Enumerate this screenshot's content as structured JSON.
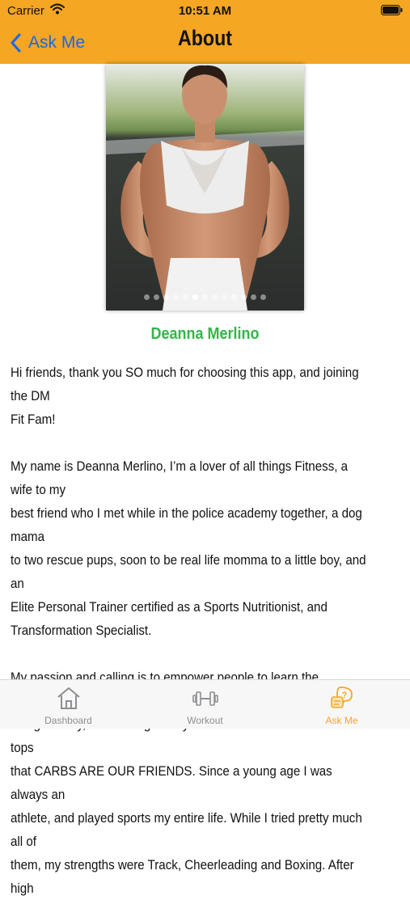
{
  "status_bar": {
    "carrier": "Carrier",
    "time": "10:51 AM"
  },
  "nav": {
    "back_label": "Ask Me",
    "title": "About"
  },
  "carousel": {
    "page_count": 13,
    "current_page": 5
  },
  "profile": {
    "name": "Deanna Merlino",
    "bio": "Hi friends, thank you SO much for choosing this app, and joining the DM\nFit Fam!\n\nMy name is Deanna Merlino, I’m a lover of all things Fitness, a wife to my\nbest friend who I met while in the police academy together, a dog mama\nto two rescue pups, soon to be real life momma to a little boy, and an\nElite Personal Trainer certified as a Sports Nutritionist, and\nTransformation Specialist.\n\nMy passion and calling is to empower people to learn the importance of\nbeing healthy, over \"being skinny\" and scream from the mountain tops\nthat CARBS ARE OUR FRIENDS. Since a young age I was always an\nathlete, and played sports my entire life. While I tried pretty much all of\nthem, my strengths were Track, Cheerleading and Boxing. After high"
  },
  "tabs": [
    {
      "label": "Dashboard",
      "icon": "house-icon",
      "active": false
    },
    {
      "label": "Workout",
      "icon": "dumbbell-icon",
      "active": false
    },
    {
      "label": "Ask Me",
      "icon": "question-bubble-icon",
      "active": true
    }
  ],
  "colors": {
    "header": "#F5A623",
    "accent": "#35B54A",
    "link": "#1769E8"
  }
}
